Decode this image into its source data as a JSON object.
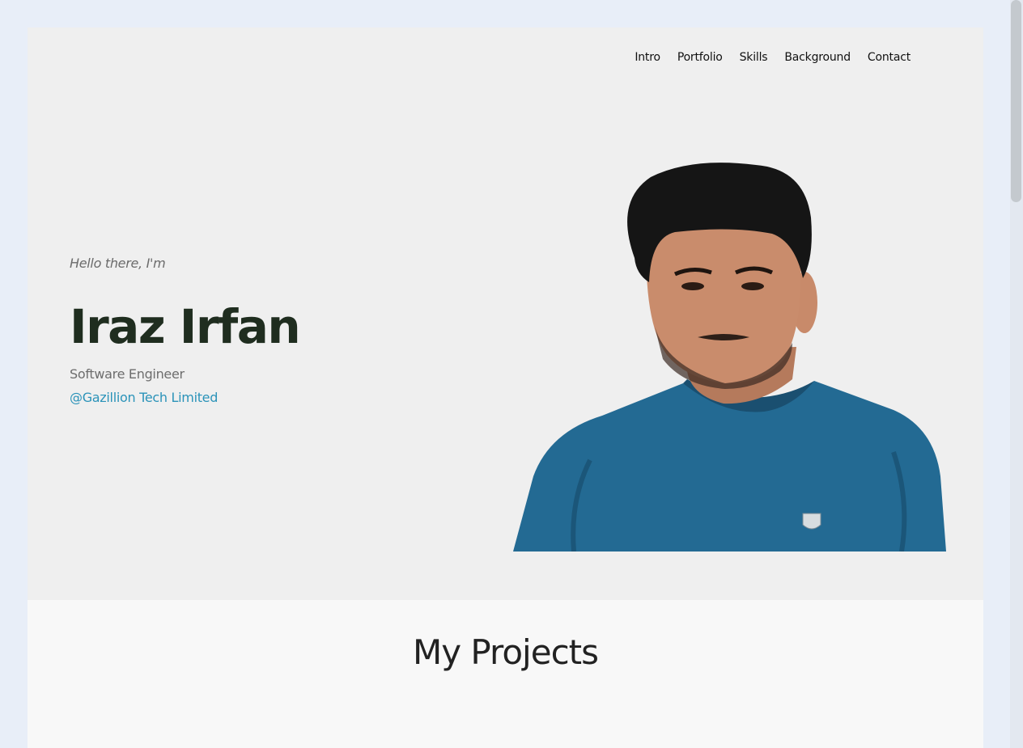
{
  "nav": {
    "items": [
      "Intro",
      "Portfolio",
      "Skills",
      "Background",
      "Contact"
    ]
  },
  "hero": {
    "greeting": "Hello there, I'm",
    "name": "Iraz Irfan",
    "role": "Software Engineer",
    "company": "@Gazillion Tech Limited",
    "company_color": "#2b93b9",
    "name_color": "#1f2d1f"
  },
  "projects": {
    "title": "My Projects"
  }
}
